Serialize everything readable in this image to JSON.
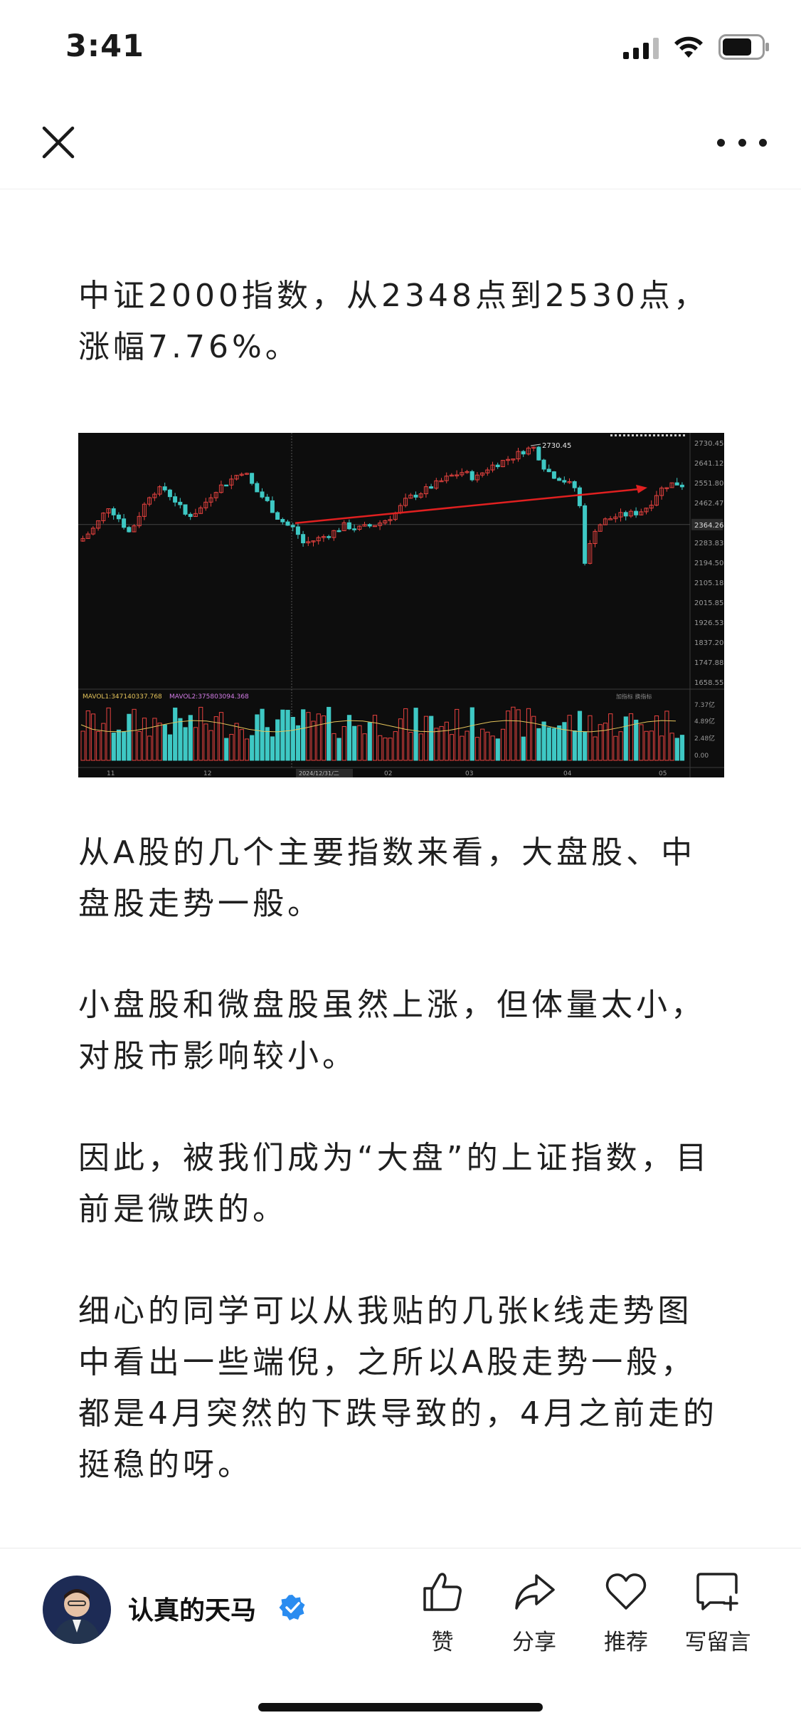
{
  "status_bar": {
    "time": "3:41"
  },
  "article": {
    "paragraphs": [
      "中证2000指数，从2348点到2530点，涨幅7.76%。",
      "从A股的几个主要指数来看，大盘股、中盘股走势一般。",
      "小盘股和微盘股虽然上涨，但体量太小，对股市影响较小。",
      "因此，被我们成为“大盘”的上证指数，目前是微跌的。",
      "细心的同学可以从我贴的几张k线走势图中看出一些端倪，之所以A股走势一般，都是4月突然的下跌导致的，4月之前走的挺稳的呀。"
    ]
  },
  "chart_data": {
    "type": "candlestick",
    "price_axis_labels": [
      "2730.45",
      "2641.12",
      "2551.80",
      "2462.47",
      "2364.26",
      "2283.83",
      "2194.50",
      "2105.18",
      "2015.85",
      "1926.53",
      "1837.20",
      "1747.88",
      "1658.55"
    ],
    "price_range": [
      1658.55,
      2730.45
    ],
    "peak_label": "2730.45",
    "current_price_label": "2364.26",
    "volume_legend": [
      "MAVOL1:347140337.768",
      "MAVOL2:375803094.368"
    ],
    "volume_axis_labels": [
      "7.37亿",
      "4.89亿",
      "2.48亿",
      "0.00"
    ],
    "volume_buttons_label": "加指标 换指标",
    "x_tick_labels": [
      "11",
      "12",
      "02",
      "03",
      "04",
      "05"
    ],
    "crosshair_date": "2024/12/31/二",
    "colors": {
      "up": "#e8423f",
      "down": "#3ec8c4",
      "arrow": "#e02020",
      "background": "#0d0d0d"
    }
  },
  "author": {
    "name": "认真的天马"
  },
  "actions": {
    "like": "赞",
    "share": "分享",
    "recommend": "推荐",
    "comment": "写留言"
  },
  "icons": [
    "close-icon",
    "more-icon",
    "like-icon",
    "share-icon",
    "heart-icon",
    "comment-icon",
    "verified-icon"
  ]
}
